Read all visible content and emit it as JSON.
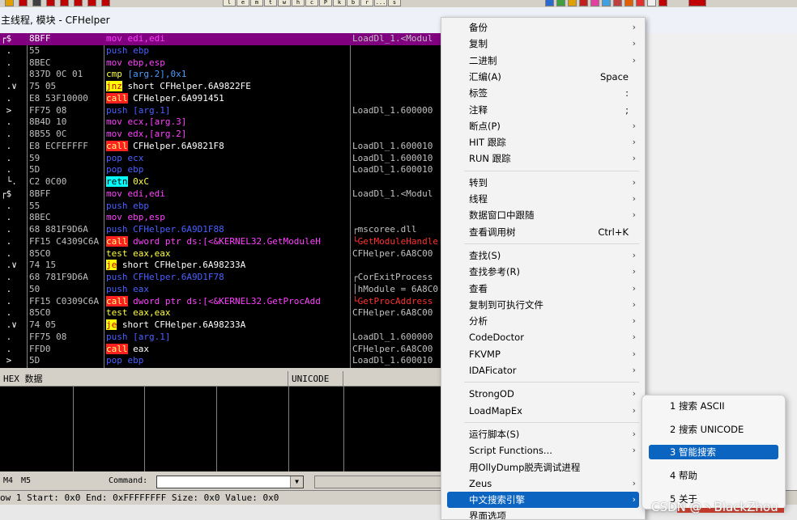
{
  "window": {
    "title": "主线程, 模块 - CFHelper"
  },
  "toolbar": {
    "letters": [
      "l",
      "e",
      "m",
      "t",
      "w",
      "h",
      "c",
      "P",
      "k",
      "b",
      "r",
      "...",
      "s"
    ]
  },
  "disasm": {
    "rows": [
      {
        "mark": "┌$",
        "hex": "8BFF",
        "mn": "mov",
        "ops": " edi,edi",
        "cmt": "LoadDl_1.<Modul",
        "kind": "mov",
        "sel": true
      },
      {
        "mark": " .",
        "hex": "55",
        "mn": "push",
        "ops": " ebp",
        "cmt": "",
        "kind": "push"
      },
      {
        "mark": " .",
        "hex": "8BEC",
        "mn": "mov",
        "ops": " ebp,esp",
        "cmt": "",
        "kind": "mov"
      },
      {
        "mark": " .",
        "hex": "837D 0C 01",
        "mn": "cmp",
        "ops": " [arg.2],0x1",
        "cmt": "",
        "kind": "cmp"
      },
      {
        "mark": " .∨",
        "hex": "75 05",
        "mn": "jnz",
        "ops": " short CFHelper.6A9822FE",
        "cmt": "",
        "kind": "jcc"
      },
      {
        "mark": " .",
        "hex": "E8 53F10000",
        "mn": "call",
        "ops": " CFHelper.6A991451",
        "cmt": "",
        "kind": "call"
      },
      {
        "mark": " >",
        "hex": "FF75 08",
        "mn": "push",
        "ops": " [arg.1]",
        "cmt": "LoadDl_1.600000",
        "kind": "push"
      },
      {
        "mark": " .",
        "hex": "8B4D 10",
        "mn": "mov",
        "ops": " ecx,[arg.3]",
        "cmt": "",
        "kind": "mov"
      },
      {
        "mark": " .",
        "hex": "8B55 0C",
        "mn": "mov",
        "ops": " edx,[arg.2]",
        "cmt": "",
        "kind": "mov"
      },
      {
        "mark": " .",
        "hex": "E8 ECFEFFFF",
        "mn": "call",
        "ops": " CFHelper.6A9821F8",
        "cmt": "LoadDl_1.600010",
        "kind": "call"
      },
      {
        "mark": " .",
        "hex": "59",
        "mn": "pop",
        "ops": " ecx",
        "cmt": "LoadDl_1.600010",
        "kind": "pop"
      },
      {
        "mark": " .",
        "hex": "5D",
        "mn": "pop",
        "ops": " ebp",
        "cmt": "LoadDl_1.600010",
        "kind": "pop"
      },
      {
        "mark": " └.",
        "hex": "C2 0C00",
        "mn": "retn",
        "ops": " 0xC",
        "cmt": "",
        "kind": "retn"
      },
      {
        "mark": "┌$",
        "hex": "8BFF",
        "mn": "mov",
        "ops": " edi,edi",
        "cmt": "LoadDl_1.<Modul",
        "kind": "mov"
      },
      {
        "mark": " .",
        "hex": "55",
        "mn": "push",
        "ops": " ebp",
        "cmt": "",
        "kind": "push"
      },
      {
        "mark": " .",
        "hex": "8BEC",
        "mn": "mov",
        "ops": " ebp,esp",
        "cmt": "",
        "kind": "mov"
      },
      {
        "mark": " .",
        "hex": "68 881F9D6A",
        "mn": "push",
        "ops": " CFHelper.6A9D1F88",
        "cmt": "┌mscoree.dll",
        "kind": "push"
      },
      {
        "mark": " .",
        "hex": "FF15 C4309C6A",
        "mn": "call",
        "ops": " dword ptr ds:[<&KERNEL32.GetModuleH",
        "cmt": "└GetModuleHandle",
        "kind": "call",
        "red": true
      },
      {
        "mark": " .",
        "hex": "85C0",
        "mn": "test",
        "ops": " eax,eax",
        "cmt": "CFHelper.6A8C00",
        "kind": "test"
      },
      {
        "mark": " .∨",
        "hex": "74 15",
        "mn": "je",
        "ops": " short CFHelper.6A98233A",
        "cmt": "",
        "kind": "jcc"
      },
      {
        "mark": " .",
        "hex": "68 781F9D6A",
        "mn": "push",
        "ops": " CFHelper.6A9D1F78",
        "cmt": "┌CorExitProcess",
        "kind": "push"
      },
      {
        "mark": " .",
        "hex": "50",
        "mn": "push",
        "ops": " eax",
        "cmt": "│hModule = 6A8C0",
        "kind": "push"
      },
      {
        "mark": " .",
        "hex": "FF15 C0309C6A",
        "mn": "call",
        "ops": " dword ptr ds:[<&KERNEL32.GetProcAdd",
        "cmt": "└GetProcAddress",
        "kind": "call",
        "red": true
      },
      {
        "mark": " .",
        "hex": "85C0",
        "mn": "test",
        "ops": " eax,eax",
        "cmt": "CFHelper.6A8C00",
        "kind": "test"
      },
      {
        "mark": " .∨",
        "hex": "74 05",
        "mn": "je",
        "ops": " short CFHelper.6A98233A",
        "cmt": "",
        "kind": "jcc"
      },
      {
        "mark": " .",
        "hex": "FF75 08",
        "mn": "push",
        "ops": " [arg.1]",
        "cmt": "LoadDl_1.600000",
        "kind": "push"
      },
      {
        "mark": " .",
        "hex": "FFD0",
        "mn": "call",
        "ops": " eax",
        "cmt": "CFHelper.6A8C00",
        "kind": "call"
      },
      {
        "mark": " >",
        "hex": "5D",
        "mn": "pop",
        "ops": " ebp",
        "cmt": "LoadDl_1.600010",
        "kind": "pop"
      }
    ]
  },
  "dump": {
    "headers": [
      "HEX 数据",
      "UNICODE"
    ]
  },
  "commandbar": {
    "m4": "M4",
    "m5": "M5",
    "label": "Command:"
  },
  "statusbar": {
    "text": "ow 1   Start: 0x0   End: 0xFFFFFFFF   Size: 0x0 Value: 0x0"
  },
  "context_menu": {
    "items": [
      {
        "label": "备份",
        "arrow": true
      },
      {
        "label": "复制",
        "arrow": true
      },
      {
        "label": "二进制",
        "arrow": true
      },
      {
        "label": "汇编(A)",
        "shortcut": "Space"
      },
      {
        "label": "标签",
        "shortcut": ":"
      },
      {
        "label": "注释",
        "shortcut": ";"
      },
      {
        "label": "断点(P)",
        "arrow": true
      },
      {
        "label": "HIT 跟踪",
        "arrow": true
      },
      {
        "label": "RUN 跟踪",
        "arrow": true
      },
      {
        "sep": true
      },
      {
        "label": "转到",
        "arrow": true
      },
      {
        "label": "线程",
        "arrow": true
      },
      {
        "label": "数据窗口中跟随",
        "arrow": true
      },
      {
        "label": "查看调用树",
        "shortcut": "Ctrl+K"
      },
      {
        "sep": true
      },
      {
        "label": "查找(S)",
        "arrow": true
      },
      {
        "label": "查找参考(R)",
        "arrow": true
      },
      {
        "label": "查看",
        "arrow": true
      },
      {
        "label": "复制到可执行文件",
        "arrow": true
      },
      {
        "label": "分析",
        "arrow": true
      },
      {
        "label": "CodeDoctor",
        "arrow": true
      },
      {
        "label": "FKVMP",
        "arrow": true
      },
      {
        "label": "IDAFicator",
        "arrow": true
      },
      {
        "sep": true
      },
      {
        "label": "StrongOD",
        "arrow": true
      },
      {
        "label": "LoadMapEx",
        "arrow": true
      },
      {
        "sep": true
      },
      {
        "label": "运行脚本(S)",
        "arrow": true
      },
      {
        "label": "Script Functions...",
        "arrow": true
      },
      {
        "label": "用OllyDump脱壳调试进程"
      },
      {
        "label": "Zeus",
        "arrow": true
      },
      {
        "label": "中文搜索引擎",
        "arrow": true,
        "highlight": true
      },
      {
        "label": "界面选项"
      }
    ]
  },
  "submenu": {
    "items": [
      {
        "label": "1 搜索 ASCII"
      },
      {
        "label": "2 搜索 UNICODE"
      },
      {
        "label": "3 智能搜索",
        "highlight": true
      },
      {
        "label": "4 帮助"
      },
      {
        "label": "5 关于"
      }
    ]
  },
  "watermark": {
    "text": "CSDN @丶BlackZhou"
  },
  "colors": {
    "menu_highlight": "#0b64c0",
    "selected_row": "#800080",
    "call_bg": "#ff2020",
    "jump_bg": "#ffff00"
  }
}
